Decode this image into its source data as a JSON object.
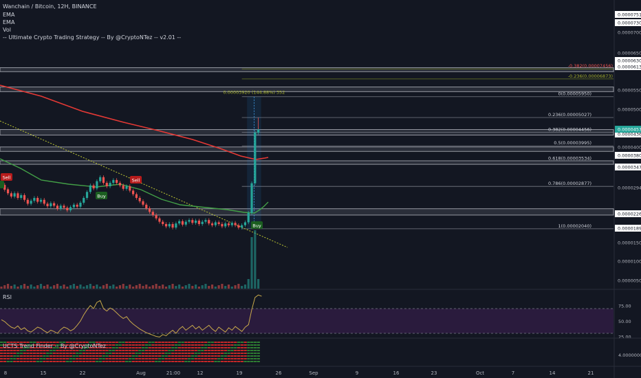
{
  "header": {
    "symbol_line": "Wanchain / Bitcoin, 12H, BINANCE",
    "indicators": [
      "EMA",
      "EMA",
      "Vol",
      "-- Ultimate Crypto Trading Strategy -- By @CryptoNTez -- v2.01 --"
    ]
  },
  "colors": {
    "background": "#131722",
    "up_candle": "#26a69a",
    "down_candle": "#ef5350",
    "ema_slow": "#e53935",
    "ema_fast": "#43a047",
    "trendline": "#c0ca33",
    "rsi_line": "#c8a94a",
    "rsi_band": "#2a1b3d",
    "sr_zone": "#9598a1",
    "buy": "#1b5e20",
    "sell": "#b71c1c"
  },
  "chart_data": {
    "type": "candlestick",
    "pair": "WAN/BTC",
    "interval": "12H",
    "exchange": "BINANCE",
    "y_axis_labels": [
      "0.00007510",
      "0.00007300",
      "0.00007000",
      "0.00006500",
      "0.00006300",
      "0.00006130",
      "0.00005500",
      "0.00005000",
      "0.00004360",
      "0.00004000",
      "0.00003800",
      "0.00003472",
      "0.00002940",
      "0.00002260",
      "0.00001890",
      "0.00001500",
      "0.00001000",
      "0.00000500"
    ],
    "x_axis_labels": [
      "8",
      "15",
      "22",
      "Aug",
      "21:00",
      "12",
      "19",
      "26",
      "Sep",
      "9",
      "16",
      "23",
      "Oct",
      "7",
      "14",
      "21"
    ],
    "last_price": "0.00004570",
    "fibonacci": [
      {
        "level": "-0.382(0.00007456)"
      },
      {
        "level": "-0.236(0.00006873)"
      },
      {
        "level": "0(0.00005950)"
      },
      {
        "level": "0.236(0.00005027)"
      },
      {
        "level": "0.382(0.00004456)"
      },
      {
        "level": "0.5(0.00003995)"
      },
      {
        "level": "0.618(0.00003534)"
      },
      {
        "level": "0.786(0.00002877)"
      },
      {
        "level": "1(0.00002040)"
      }
    ],
    "measure_label": "0.00003920 (144.88%) 352",
    "signals": [
      {
        "type": "sell",
        "label": "Sell"
      },
      {
        "type": "buy",
        "label": "Buy"
      },
      {
        "type": "sell",
        "label": "Sell"
      },
      {
        "type": "buy",
        "label": "Buy"
      }
    ],
    "candles": [
      [
        3e-05,
        2.9e-05
      ],
      [
        2.91e-05,
        2.8e-05
      ],
      [
        2.81e-05,
        2.72e-05
      ],
      [
        2.72e-05,
        2.65e-05
      ],
      [
        2.65e-05,
        2.72e-05
      ],
      [
        2.72e-05,
        2.62e-05
      ],
      [
        2.62e-05,
        2.68e-05
      ],
      [
        2.68e-05,
        2.58e-05
      ],
      [
        2.58e-05,
        2.5e-05
      ],
      [
        2.5e-05,
        2.56e-05
      ],
      [
        2.56e-05,
        2.62e-05
      ],
      [
        2.62e-05,
        2.54e-05
      ],
      [
        2.54e-05,
        2.58e-05
      ],
      [
        2.58e-05,
        2.5e-05
      ],
      [
        2.5e-05,
        2.45e-05
      ],
      [
        2.45e-05,
        2.51e-05
      ],
      [
        2.51e-05,
        2.46e-05
      ],
      [
        2.46e-05,
        2.4e-05
      ],
      [
        2.4e-05,
        2.46e-05
      ],
      [
        2.46e-05,
        2.42e-05
      ],
      [
        2.42e-05,
        2.37e-05
      ],
      [
        2.37e-05,
        2.43e-05
      ],
      [
        2.43e-05,
        2.48e-05
      ],
      [
        2.48e-05,
        2.44e-05
      ],
      [
        2.44e-05,
        2.52e-05
      ],
      [
        2.52e-05,
        2.62e-05
      ],
      [
        2.62e-05,
        2.75e-05
      ],
      [
        2.75e-05,
        2.9e-05
      ],
      [
        2.9e-05,
        2.83e-05
      ],
      [
        2.83e-05,
        3e-05
      ],
      [
        3e-05,
        3.1e-05
      ],
      [
        3.1e-05,
        2.96e-05
      ],
      [
        2.96e-05,
        2.88e-05
      ],
      [
        2.88e-05,
        2.96e-05
      ],
      [
        2.96e-05,
        3.03e-05
      ],
      [
        3.03e-05,
        2.96e-05
      ],
      [
        2.96e-05,
        2.9e-05
      ],
      [
        2.9e-05,
        2.82e-05
      ],
      [
        2.82e-05,
        2.88e-05
      ],
      [
        2.88e-05,
        2.78e-05
      ],
      [
        2.78e-05,
        2.7e-05
      ],
      [
        2.7e-05,
        2.62e-05
      ],
      [
        2.62e-05,
        2.55e-05
      ],
      [
        2.55e-05,
        2.48e-05
      ],
      [
        2.48e-05,
        2.41e-05
      ],
      [
        2.41e-05,
        2.34e-05
      ],
      [
        2.34e-05,
        2.28e-05
      ],
      [
        2.28e-05,
        2.22e-05
      ],
      [
        2.22e-05,
        2.16e-05
      ],
      [
        2.16e-05,
        2.12e-05
      ],
      [
        2.12e-05,
        2.08e-05
      ],
      [
        2.08e-05,
        2.12e-05
      ],
      [
        2.12e-05,
        2.06e-05
      ],
      [
        2.06e-05,
        2.13e-05
      ],
      [
        2.13e-05,
        2.17e-05
      ],
      [
        2.17e-05,
        2.11e-05
      ],
      [
        2.11e-05,
        2.16e-05
      ],
      [
        2.16e-05,
        2.19e-05
      ],
      [
        2.19e-05,
        2.14e-05
      ],
      [
        2.14e-05,
        2.18e-05
      ],
      [
        2.18e-05,
        2.12e-05
      ],
      [
        2.12e-05,
        2.16e-05
      ],
      [
        2.16e-05,
        2.19e-05
      ],
      [
        2.19e-05,
        2.13e-05
      ],
      [
        2.13e-05,
        2.1e-05
      ],
      [
        2.1e-05,
        2.15e-05
      ],
      [
        2.15e-05,
        2.12e-05
      ],
      [
        2.12e-05,
        2.08e-05
      ],
      [
        2.08e-05,
        2.13e-05
      ],
      [
        2.13e-05,
        2.1e-05
      ],
      [
        2.1e-05,
        2.14e-05
      ],
      [
        2.14e-05,
        2.1e-05
      ],
      [
        2.1e-05,
        2.06e-05
      ],
      [
        2.06e-05,
        2.1e-05
      ],
      [
        2.1e-05,
        2.15e-05
      ],
      [
        2.15e-05,
        2.32e-05
      ],
      [
        2.32e-05,
        2.95e-05
      ],
      [
        2.95e-05,
        4.45e-05
      ],
      [
        4.45e-05,
        4.57e-05
      ]
    ]
  },
  "rsi_pane": {
    "title": "RSI",
    "axis_labels": [
      "75.00",
      "50.00",
      "25.00"
    ],
    "levels": [
      70,
      30
    ],
    "values": [
      52,
      49,
      44,
      40,
      38,
      42,
      36,
      39,
      34,
      32,
      36,
      40,
      38,
      34,
      31,
      35,
      33,
      30,
      36,
      40,
      38,
      34,
      37,
      43,
      50,
      60,
      68,
      75,
      70,
      80,
      83,
      70,
      66,
      71,
      68,
      63,
      58,
      54,
      57,
      50,
      45,
      41,
      37,
      34,
      31,
      29,
      27,
      25,
      24,
      28,
      26,
      31,
      35,
      30,
      37,
      41,
      35,
      39,
      43,
      37,
      41,
      35,
      39,
      43,
      37,
      33,
      40,
      36,
      32,
      39,
      35,
      41,
      37,
      33,
      40,
      44,
      68,
      88,
      92,
      90
    ]
  },
  "trend_pane": {
    "title": "UCTS Trend Finder -- By @CryptoNTez",
    "axis_labels": [
      "4.00000000"
    ]
  }
}
